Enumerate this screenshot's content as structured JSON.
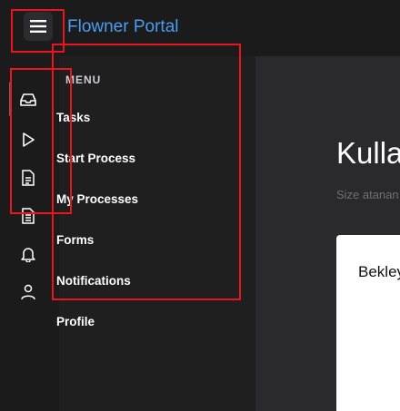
{
  "header": {
    "app_title": "Flowner Portal",
    "menu_icon": "hamburger-icon"
  },
  "rail": {
    "icons": [
      "inbox-icon",
      "play-icon",
      "document-icon",
      "document-list-icon",
      "bell-icon",
      "user-icon"
    ]
  },
  "panel": {
    "title": "MENU",
    "items": [
      {
        "label": "Tasks"
      },
      {
        "label": "Start Process"
      },
      {
        "label": "My Processes"
      },
      {
        "label": "Forms"
      },
      {
        "label": "Notifications"
      },
      {
        "label": "Profile"
      }
    ]
  },
  "main": {
    "title": "Kullanıcı Görevleri",
    "subtitle": "Size atanan görevler",
    "card_title": "Bekleyen Görevler"
  },
  "colors": {
    "brand": "#4a9df0",
    "highlight": "#e8141e"
  }
}
